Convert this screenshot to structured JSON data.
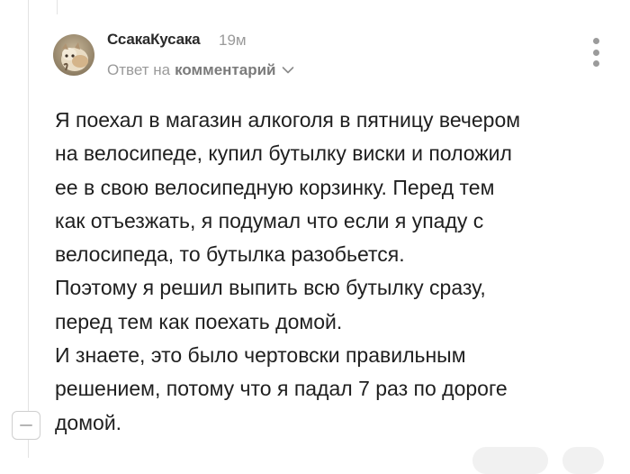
{
  "comment": {
    "author": "СсакаКусака",
    "time": "19м",
    "reply_prefix": "Ответ на",
    "reply_target": "комментарий",
    "paragraphs": [
      "Я поехал в магазин алкоголя в пятницу вечером\nна велосипеде, купил бутылку виски и положил\nее в свою велосипедную корзинку. Перед тем\nкак отъезжать, я подумал что если я упаду с\nвелосипеда, то бутылка разобьется.",
      "Поэтому я решил выпить всю бутылку сразу,\nперед тем как поехать домой.",
      "И знаете, это было чертовски правильным\nрешением, потому что я падал 7 раз по дороге\nдомой."
    ]
  },
  "icons": {
    "menu": "vertical-dots-icon",
    "chevron": "chevron-down-icon",
    "collapse": "minus-icon"
  },
  "colors": {
    "text": "#1f1f1f",
    "muted": "#9a9a9a",
    "thread_line": "#e3e3e3"
  }
}
